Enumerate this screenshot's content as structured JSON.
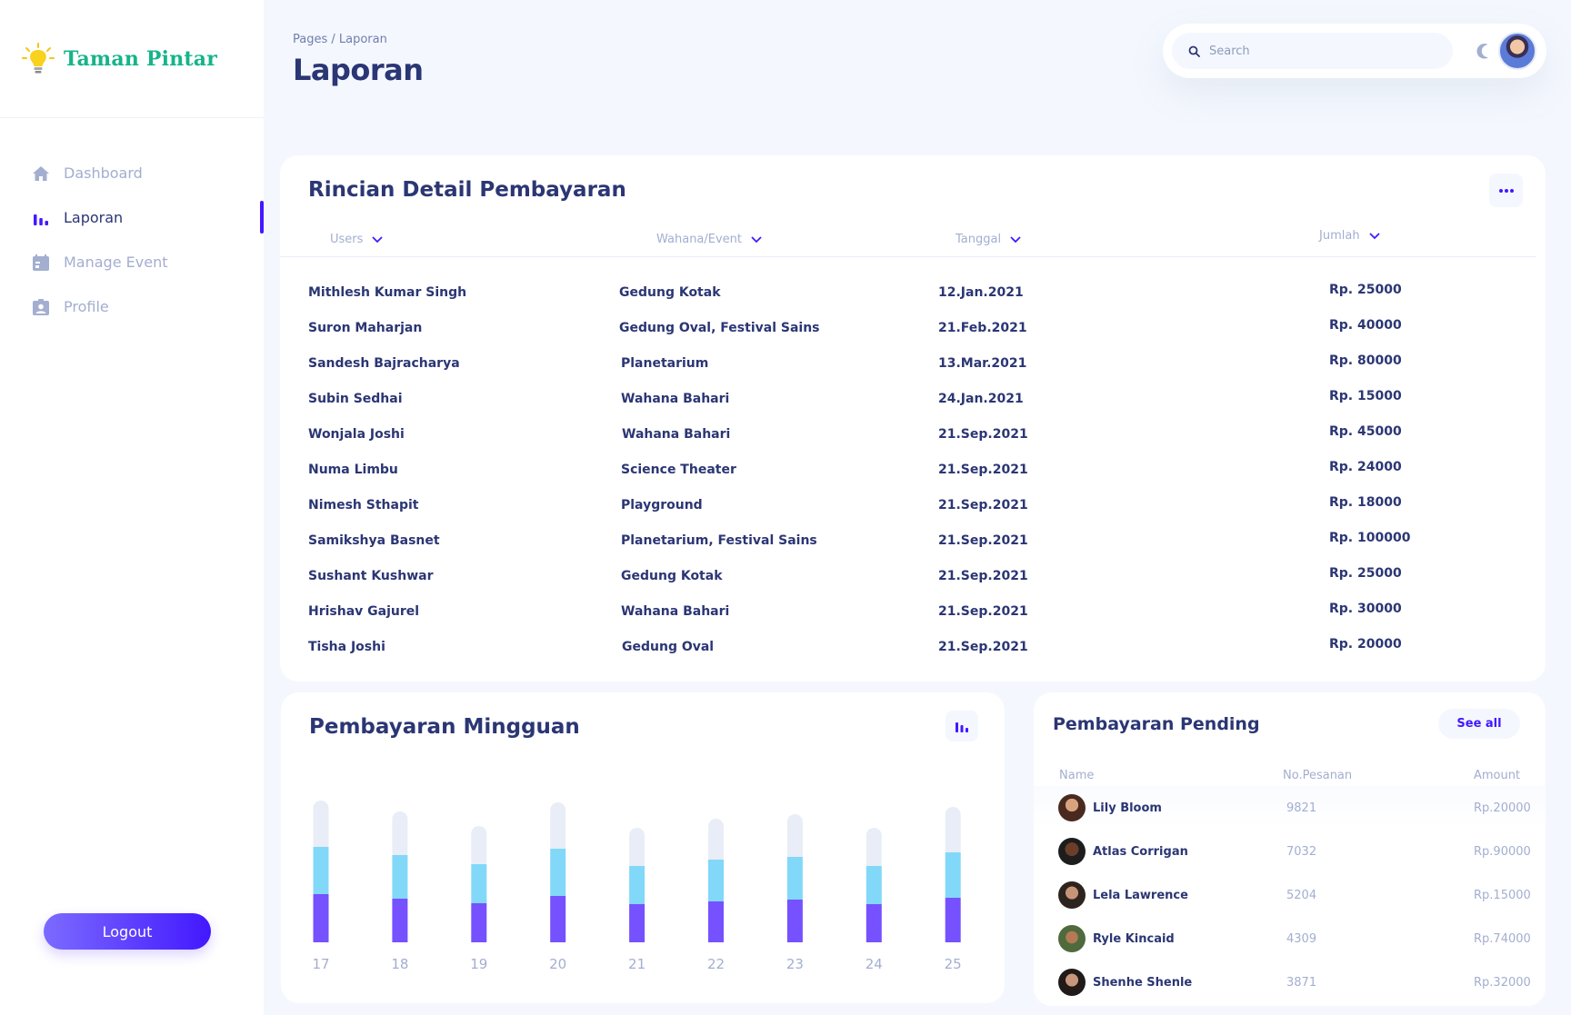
{
  "sidebar": {
    "brand": "Taman Pintar",
    "items": [
      {
        "label": "Dashboard",
        "icon": "home-icon"
      },
      {
        "label": "Laporan",
        "icon": "bar-chart-icon"
      },
      {
        "label": "Manage Event",
        "icon": "calendar-icon"
      },
      {
        "label": "Profile",
        "icon": "profile-badge-icon"
      }
    ],
    "active_index": 1,
    "logout_label": "Logout"
  },
  "header": {
    "breadcrumb": "Pages / Laporan",
    "title": "Laporan",
    "search_placeholder": "Search"
  },
  "detail": {
    "title": "Rincian Detail Pembayaran",
    "columns": [
      "Users",
      "Wahana/Event",
      "Tanggal",
      "Jumlah"
    ],
    "rows": [
      {
        "user": "Mithlesh Kumar Singh",
        "event": "Gedung Kotak",
        "date": "12.Jan.2021",
        "amount": "Rp. 25000"
      },
      {
        "user": "Suron Maharjan",
        "event": "Gedung Oval, Festival Sains",
        "date": "21.Feb.2021",
        "amount": "Rp. 40000"
      },
      {
        "user": "Sandesh Bajracharya",
        "event": "Planetarium",
        "date": "13.Mar.2021",
        "amount": "Rp. 80000"
      },
      {
        "user": "Subin Sedhai",
        "event": "Wahana Bahari",
        "date": "24.Jan.2021",
        "amount": "Rp. 15000"
      },
      {
        "user": "Wonjala Joshi",
        "event": "Wahana Bahari",
        "date": "21.Sep.2021",
        "amount": "Rp. 45000"
      },
      {
        "user": "Numa Limbu",
        "event": "Science Theater",
        "date": "21.Sep.2021",
        "amount": "Rp. 24000"
      },
      {
        "user": "Nimesh Sthapit",
        "event": "Playground",
        "date": "21.Sep.2021",
        "amount": "Rp. 18000"
      },
      {
        "user": "Samikshya Basnet",
        "event": "Planetarium, Festival Sains",
        "date": "21.Sep.2021",
        "amount": "Rp. 100000"
      },
      {
        "user": "Sushant Kushwar",
        "event": "Gedung Kotak",
        "date": "21.Sep.2021",
        "amount": "Rp. 25000"
      },
      {
        "user": "Hrishav Gajurel",
        "event": "Wahana Bahari",
        "date": "21.Sep.2021",
        "amount": "Rp. 30000"
      },
      {
        "user": "Tisha Joshi",
        "event": "Gedung Oval",
        "date": "21.Sep.2021",
        "amount": "Rp. 20000"
      }
    ]
  },
  "weekly": {
    "title": "Pembayaran Mingguan"
  },
  "chart_data": {
    "type": "bar",
    "stacked": true,
    "categories": [
      "17",
      "18",
      "19",
      "20",
      "21",
      "22",
      "23",
      "24",
      "25"
    ],
    "series": [
      {
        "color": "#7551ff",
        "values": [
          53,
          48,
          43,
          51,
          42,
          45,
          47,
          42,
          49
        ]
      },
      {
        "color": "#82d8f8",
        "values": [
          52,
          48,
          43,
          52,
          42,
          46,
          47,
          42,
          50
        ]
      },
      {
        "color": "#e9edf7",
        "values": [
          51,
          48,
          42,
          51,
          42,
          45,
          47,
          42,
          50
        ]
      }
    ],
    "grid": false,
    "legend": "none"
  },
  "pending": {
    "title": "Pembayaran Pending",
    "see_all": "See all",
    "columns": [
      "Name",
      "No.Pesanan",
      "Amount"
    ],
    "rows": [
      {
        "name": "Lily Bloom",
        "order": "9821",
        "amount": "Rp.20000"
      },
      {
        "name": "Atlas Corrigan",
        "order": "7032",
        "amount": "Rp.90000"
      },
      {
        "name": "Lela Lawrence",
        "order": "5204",
        "amount": "Rp.15000"
      },
      {
        "name": "Ryle Kincaid",
        "order": "4309",
        "amount": "Rp.74000"
      },
      {
        "name": "Shenhe Shenle",
        "order": "3871",
        "amount": "Rp.32000"
      }
    ]
  },
  "colors": {
    "primary": "#4318ff",
    "navy": "#2b3674",
    "muted": "#a3aed0",
    "brand": "#16b48a"
  }
}
